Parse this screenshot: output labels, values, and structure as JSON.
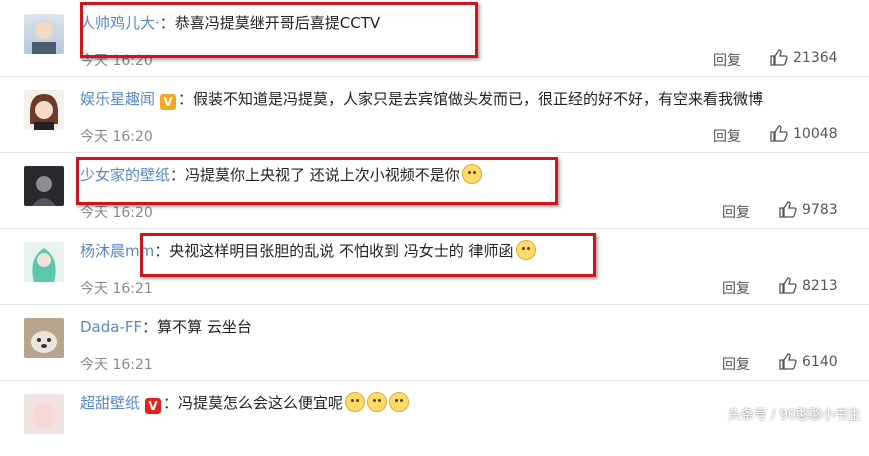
{
  "comments": [
    {
      "username": "人帅鸡儿大·",
      "verified": "",
      "text": "恭喜冯提莫继开哥后喜提CCTV",
      "emojis": 0,
      "time": "今天 16:20",
      "reply": "回复",
      "likes": "21364"
    },
    {
      "username": "娱乐星趣闻",
      "verified": "V",
      "text": "假装不知道是冯提莫，人家只是去宾馆做头发而已，很正经的好不好，有空来看我微博",
      "emojis": 0,
      "time": "今天 16:20",
      "reply": "回复",
      "likes": "10048"
    },
    {
      "username": "少女家的壁纸",
      "verified": "",
      "text": "冯提莫你上央视了 还说上次小视频不是你",
      "emojis": 1,
      "time": "今天 16:20",
      "reply": "回复",
      "likes": "9783"
    },
    {
      "username": "杨沐晨mm",
      "verified": "",
      "text": "央视这样明目张胆的乱说 不怕收到 冯女士的 律师函",
      "emojis": 1,
      "time": "今天 16:21",
      "reply": "回复",
      "likes": "8213"
    },
    {
      "username": "Dada-FF",
      "verified": "",
      "text": "算不算 云坐台",
      "emojis": 0,
      "time": "今天 16:21",
      "reply": "回复",
      "likes": "6140"
    },
    {
      "username": "超甜壁纸",
      "verified": "V",
      "text": "冯提莫怎么会这么便宜呢",
      "emojis": 3,
      "time": "",
      "reply": "",
      "likes": ""
    }
  ],
  "separator": "：",
  "watermark": "头条号 / 90憨憨小书生",
  "colors": {
    "username": "#5b88c5",
    "highlight_box": "#d0141b",
    "time": "#8a8a8a"
  }
}
